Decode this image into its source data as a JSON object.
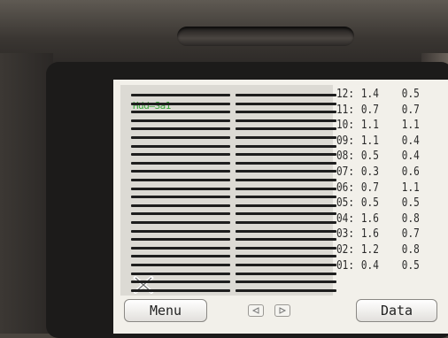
{
  "header": {
    "label": "Hdd—Sa1"
  },
  "readouts": [
    {
      "channel": "12:",
      "value1": "1.4",
      "value2": "0.5"
    },
    {
      "channel": "11:",
      "value1": "0.7",
      "value2": "0.7"
    },
    {
      "channel": "10:",
      "value1": "1.1",
      "value2": "1.1"
    },
    {
      "channel": "09:",
      "value1": "1.1",
      "value2": "0.4"
    },
    {
      "channel": "08:",
      "value1": "0.5",
      "value2": "0.4"
    },
    {
      "channel": "07:",
      "value1": "0.3",
      "value2": "0.6"
    },
    {
      "channel": "06:",
      "value1": "0.7",
      "value2": "1.1"
    },
    {
      "channel": "05:",
      "value1": "0.5",
      "value2": "0.5"
    },
    {
      "channel": "04:",
      "value1": "1.6",
      "value2": "0.8"
    },
    {
      "channel": "03:",
      "value1": "1.6",
      "value2": "0.7"
    },
    {
      "channel": "02:",
      "value1": "1.2",
      "value2": "0.8"
    },
    {
      "channel": "01:",
      "value1": "0.4",
      "value2": "0.5"
    }
  ],
  "buttons": {
    "menu": "Menu",
    "data": "Data"
  },
  "icons": {
    "prev": "triangle-left-icon",
    "next": "triangle-right-icon",
    "x": "x-icon"
  },
  "colors": {
    "screen_bg": "#f2f0ea",
    "panel_bg": "#dcdad4",
    "label_green": "#3ba83b"
  }
}
